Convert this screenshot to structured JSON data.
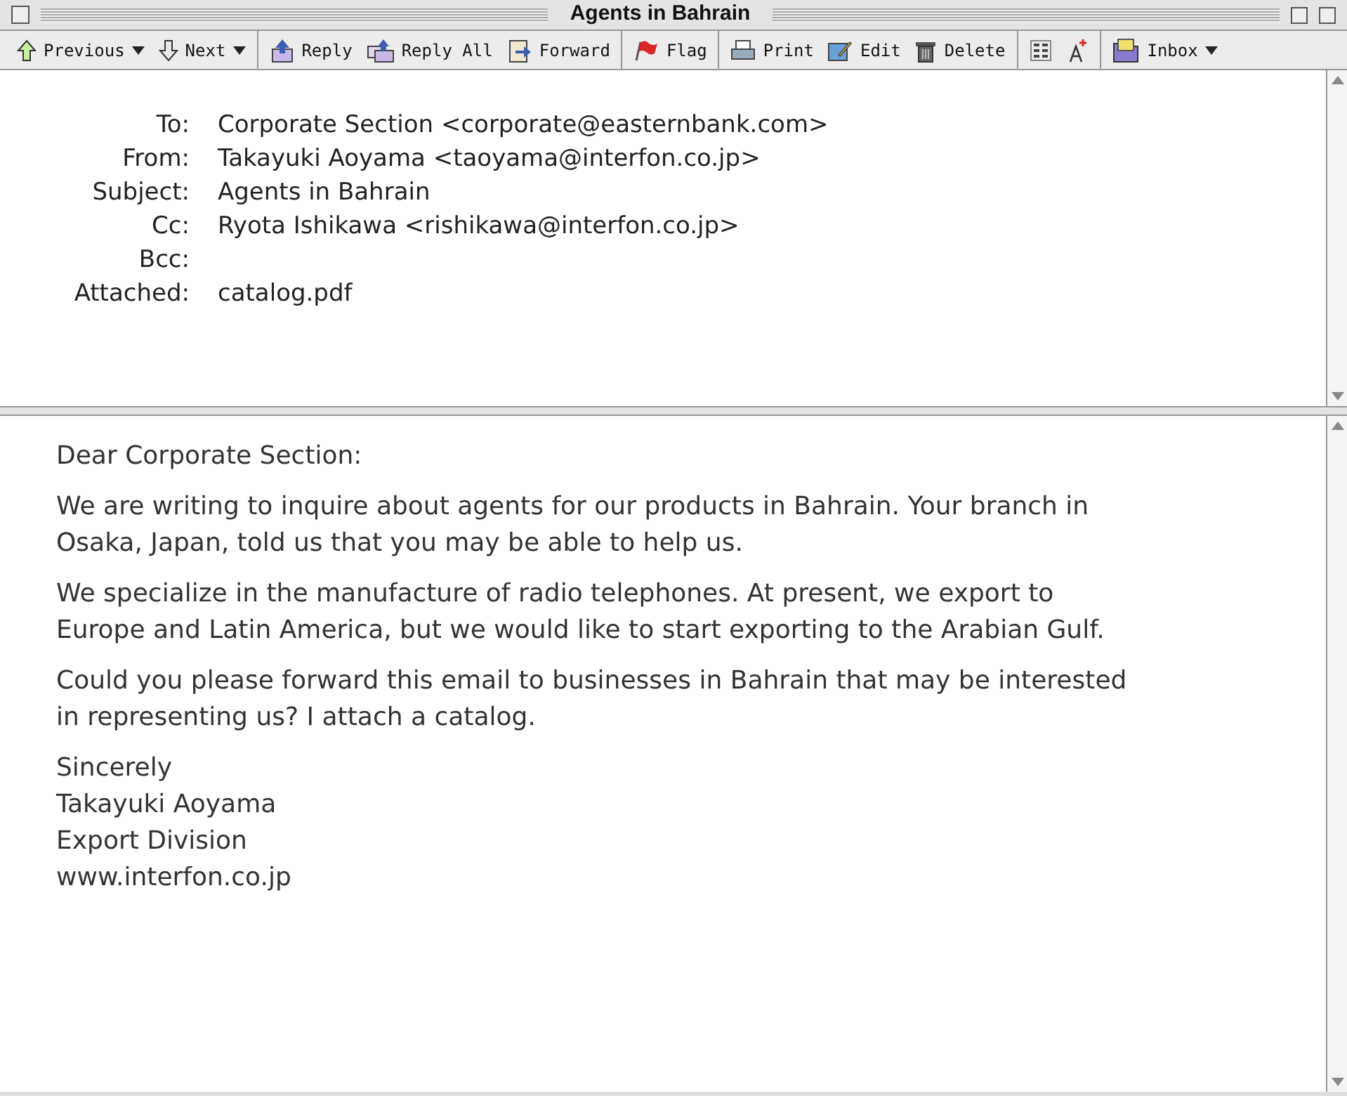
{
  "window": {
    "title": "Agents in Bahrain"
  },
  "toolbar": [
    [
      {
        "label": "Previous",
        "dropdown": true
      },
      {
        "label": "Next",
        "dropdown": true
      }
    ],
    [
      {
        "label": "Reply",
        "dropdown": false
      },
      {
        "label": "Reply All",
        "dropdown": false
      },
      {
        "label": "Forward",
        "dropdown": false
      }
    ],
    [
      {
        "label": "Flag",
        "dropdown": false
      }
    ],
    [
      {
        "label": "Print",
        "dropdown": false
      },
      {
        "label": "Edit",
        "dropdown": false
      },
      {
        "label": "Delete",
        "dropdown": false
      }
    ],
    [
      {
        "dropdown": false
      },
      {
        "dropdown": false
      }
    ],
    [
      {
        "label": "Inbox",
        "dropdown": true
      }
    ]
  ],
  "header": [
    {
      "label": "To:",
      "value": "Corporate Section <corporate@easternbank.com>"
    },
    {
      "label": "From:",
      "value": "Takayuki Aoyama <taoyama@interfon.co.jp>"
    },
    {
      "label": "Subject:",
      "value": "Agents in Bahrain"
    },
    {
      "label": "Cc:",
      "value": "Ryota Ishikawa <rishikawa@interfon.co.jp>"
    },
    {
      "label": "Bcc:"
    },
    {
      "label": "Attached:",
      "value": "catalog.pdf"
    }
  ],
  "body": {
    "greeting": "Dear Corporate Section:",
    "paragraphs": [
      "We are writing to inquire about agents for our products in Bahrain. Your branch in Osaka, Japan, told us that you may be able to help us.",
      "We specialize in the manufacture of radio telephones. At present, we export to Europe and Latin America, but we would like to start exporting to the Arabian Gulf.",
      "Could you please forward this email to businesses in Bahrain that may be interested in representing us? I attach a catalog."
    ],
    "signature": [
      "Sincerely",
      "Takayuki Aoyama",
      "Export Division",
      "www.interfon.co.jp"
    ]
  }
}
